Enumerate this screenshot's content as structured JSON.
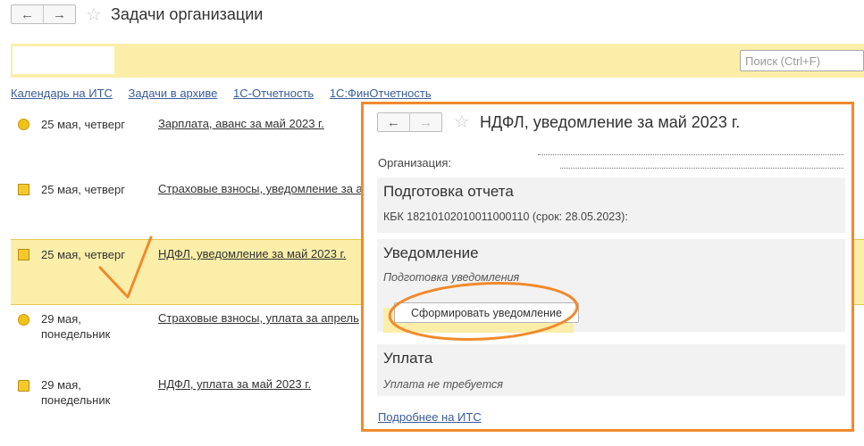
{
  "header": {
    "back_icon": "←",
    "forward_icon": "→",
    "title": "Задачи организации"
  },
  "toolbar": {
    "search_placeholder": "Поиск (Ctrl+F)"
  },
  "links": [
    "Календарь на ИТС",
    "Задачи в архиве",
    "1С-Отчетность",
    "1С:ФинОтчетность"
  ],
  "tasks": [
    {
      "icon": "coin-icon",
      "date": "25 мая, четверг",
      "date2": "",
      "task": "Зарплата, аванс за май 2023 г."
    },
    {
      "icon": "envelope-icon",
      "date": "25 мая, четверг",
      "date2": "",
      "task": "Страховые взносы, уведомление за а"
    },
    {
      "icon": "envelope-icon",
      "date": "25 мая, четверг",
      "date2": "",
      "task": "НДФЛ, уведомление за май 2023 г."
    },
    {
      "icon": "coin-icon",
      "date": "29 мая,",
      "date2": "понедельник",
      "task": "Страховые взносы, уплата за апрель"
    },
    {
      "icon": "bookmark-icon",
      "date": "29 мая,",
      "date2": "понедельник",
      "task": "НДФЛ, уплата за май 2023 г."
    }
  ],
  "popup": {
    "title": "НДФЛ, уведомление за май 2023 г.",
    "org_label": "Организация:",
    "section1": {
      "heading": "Подготовка отчета",
      "text": "КБК 18210102010011000110 (срок: 28.05.2023):"
    },
    "section2": {
      "heading": "Уведомление",
      "subtext": "Подготовка уведомления",
      "button": "Сформировать уведомление"
    },
    "section3": {
      "heading": "Уплата",
      "subtext": "Уплата не требуется"
    },
    "more_link": "Подробнее на ИТС"
  },
  "colors": {
    "accent_orange": "#f08a2d",
    "selection_yellow": "#fbeea9",
    "link_blue": "#3a5c9a"
  }
}
